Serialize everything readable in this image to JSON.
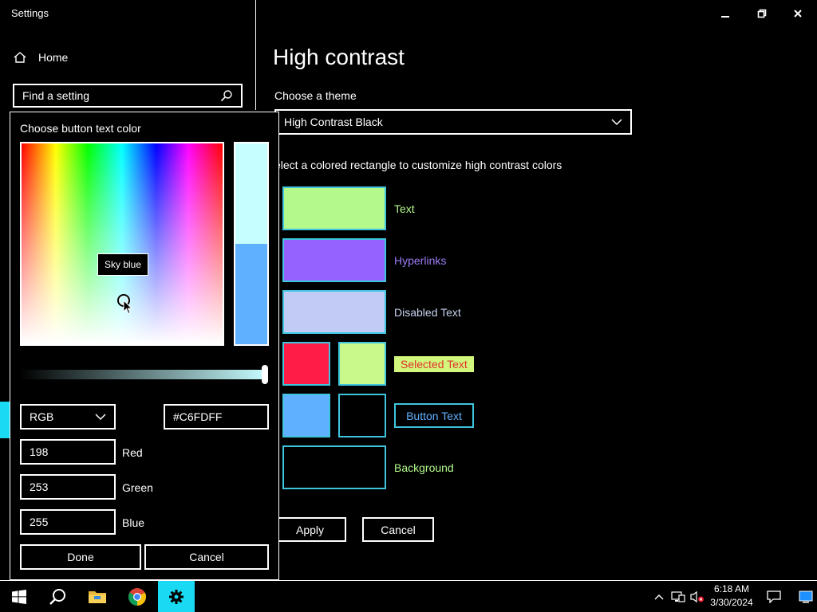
{
  "window": {
    "title": "Settings",
    "minimize_glyph": "—",
    "restore_glyph": "❐",
    "close_glyph": "✕"
  },
  "sidebar": {
    "home_label": "Home",
    "search_placeholder": "Find a setting"
  },
  "main": {
    "title": "High contrast",
    "choose_theme_label": "Choose a theme",
    "theme_value": "High Contrast Black",
    "description": "elect a colored rectangle to customize high contrast colors",
    "items": {
      "text": {
        "label": "Text",
        "color": "#b4f98c",
        "label_color": "#b4f98c"
      },
      "hyperlinks": {
        "label": "Hyperlinks",
        "color": "#9561ff",
        "label_color": "#9d7cf7"
      },
      "disabled": {
        "label": "Disabled Text",
        "color": "#c2cbf5",
        "label_color": "#c7d3ef"
      },
      "selected": {
        "label": "Selected Text",
        "bg_color": "#ff1d47",
        "fg_color": "#c9f98a",
        "label_color": "#e0322b",
        "label_bg": "#d1f87c"
      },
      "button": {
        "label": "Button Text",
        "bg_color": "#5fb0ff",
        "fg_color": "#000000",
        "label_color": "#5fb0ff"
      },
      "background": {
        "label": "Background",
        "color": "#000000",
        "label_color": "#b4f98c"
      }
    },
    "apply_label": "Apply",
    "cancel_label": "Cancel"
  },
  "dialog": {
    "title": "Choose button text color",
    "tooltip": "Sky blue",
    "mode_value": "RGB",
    "hex_value": "#C6FDFF",
    "red_value": "198",
    "red_label": "Red",
    "green_value": "253",
    "green_label": "Green",
    "blue_value": "255",
    "blue_label": "Blue",
    "done_label": "Done",
    "cancel_label": "Cancel",
    "slider_level": 1.0,
    "new_color": "#c6fdff",
    "old_color": "#5fb0ff"
  },
  "taskbar": {
    "time": "6:18 AM",
    "date": "3/30/2024",
    "icons": [
      "windows-start-icon",
      "search-icon",
      "file-explorer-icon",
      "chrome-icon",
      "settings-icon"
    ],
    "tray_icons": [
      "chevron-up-icon",
      "network-icon",
      "volume-muted-icon",
      "notification-icon",
      "show-desktop-icon"
    ]
  }
}
